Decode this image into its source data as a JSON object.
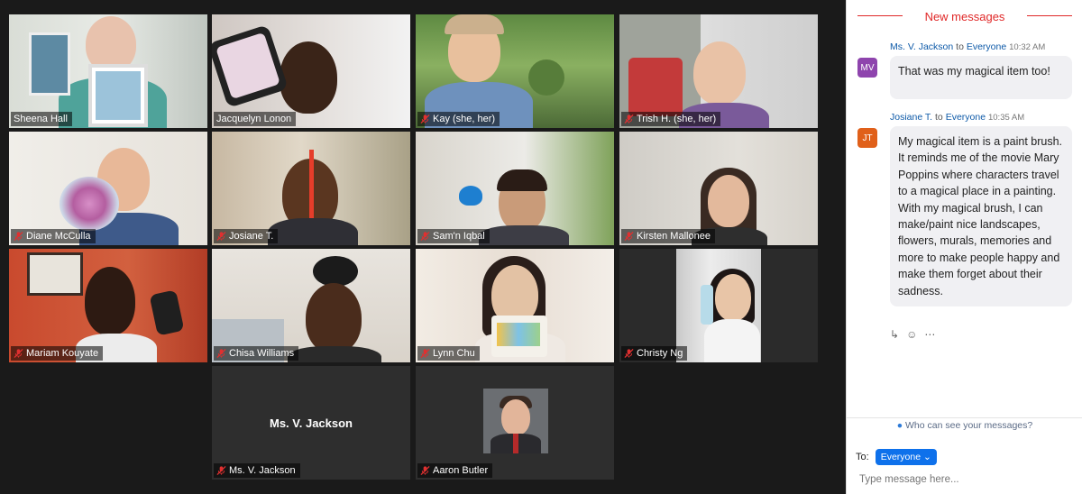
{
  "participants": [
    {
      "name": "Sheena Hall",
      "muted": false
    },
    {
      "name": "Jacquelyn Lonon",
      "muted": false,
      "active": true
    },
    {
      "name": "Kay (she, her)",
      "muted": true
    },
    {
      "name": "Trish H. (she, her)",
      "muted": true
    },
    {
      "name": "Diane McCulla",
      "muted": true
    },
    {
      "name": "Josiane T.",
      "muted": true
    },
    {
      "name": "Sam'n Iqbal",
      "muted": true
    },
    {
      "name": "Kirsten Mallonee",
      "muted": true
    },
    {
      "name": "Mariam Kouyate",
      "muted": true
    },
    {
      "name": "Chisa Williams",
      "muted": true
    },
    {
      "name": "Lynn Chu",
      "muted": true
    },
    {
      "name": "Christy Ng",
      "muted": true
    },
    {
      "name": "Ms. V. Jackson",
      "muted": true,
      "video_off_label": "Ms. V. Jackson"
    },
    {
      "name": "Aaron Butler",
      "muted": true
    }
  ],
  "chat": {
    "new_messages_label": "New messages",
    "messages": [
      {
        "initials": "MV",
        "sender": "Ms. V. Jackson",
        "to_word": "to",
        "recipient": "Everyone",
        "time": "10:32 AM",
        "text": "That was my magical item too!",
        "avatar_color": "#8e44ad"
      },
      {
        "initials": "JT",
        "sender": "Josiane T.",
        "to_word": "to",
        "recipient": "Everyone",
        "time": "10:35 AM",
        "text": "My magical item is a paint brush. It reminds me of the movie Mary Poppins where characters travel to a magical place in a painting. With my magical brush, I can make/paint nice landscapes, flowers, murals, memories and more to make people happy and make them forget about their sadness.",
        "avatar_color": "#e0601a"
      }
    ],
    "who_can_see": "Who can see your messages?",
    "to_label": "To:",
    "recipient_button": "Everyone",
    "input_placeholder": "Type message here..."
  }
}
